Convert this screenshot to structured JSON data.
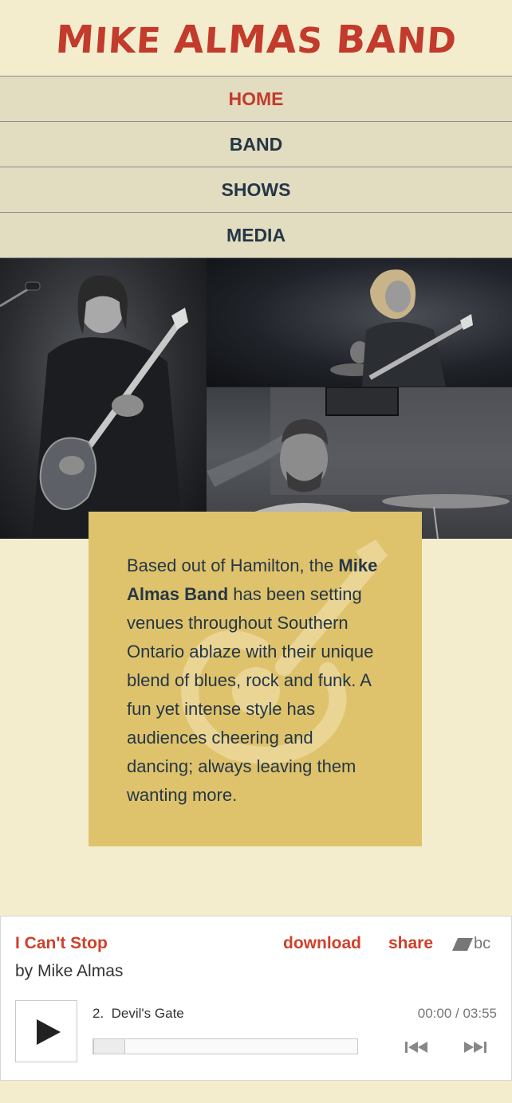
{
  "header": {
    "logo_text": "MIKE ALMAS BAND"
  },
  "nav": {
    "items": [
      {
        "label": "HOME",
        "active": true
      },
      {
        "label": "BAND",
        "active": false
      },
      {
        "label": "SHOWS",
        "active": false
      },
      {
        "label": "MEDIA",
        "active": false
      }
    ]
  },
  "about": {
    "text_before": "Based out of Hamilton, the",
    "band_name": "Mike Almas Band",
    "text_after": "has been setting venues throughout Southern Ontario ablaze with their unique blend of blues, rock and funk. A fun yet intense style has audiences cheering and dancing; always leaving them wanting more."
  },
  "player": {
    "album_title": "I Can't Stop",
    "artist": "by Mike Almas",
    "download_label": "download",
    "share_label": "share",
    "bc_logo_text": "bc",
    "track_number": "2.",
    "track_title": "Devil's Gate",
    "time": "00:00 / 03:55",
    "progress": 0
  },
  "colors": {
    "accent": "#c23b2c",
    "nav_text": "#243746",
    "nav_bg": "#e2dcc0",
    "page_bg": "#f3edcd",
    "card_bg": "#dfc26c"
  }
}
